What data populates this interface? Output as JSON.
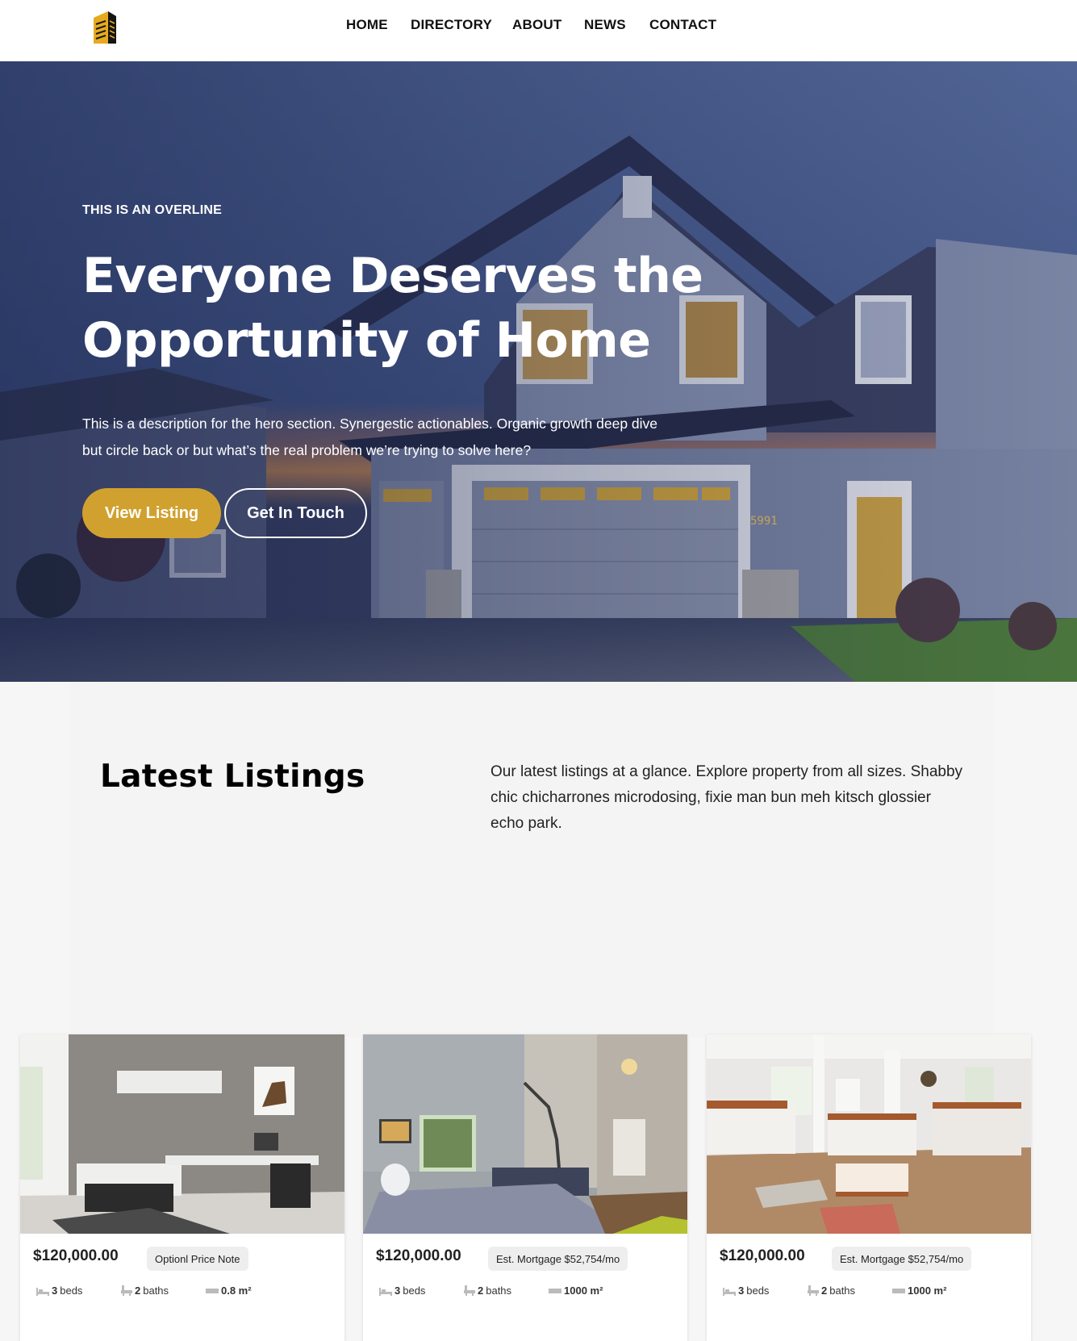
{
  "nav": {
    "logo_icon": "building-logo-icon",
    "items": [
      "HOME",
      "DIRECTORY",
      "ABOUT",
      "NEWS",
      "CONTACT"
    ]
  },
  "hero": {
    "overline": "THIS IS AN OVERLINE",
    "title": "Everyone Deserves the Opportunity of Home",
    "description": "This is a description for the hero section. Synergestic actionables. Organic growth deep dive but circle back or but what’s the real problem we’re trying to solve here?",
    "primary_button": "View Listing",
    "secondary_button": "Get In Touch",
    "house_number": "5991"
  },
  "listings": {
    "title": "Latest Listings",
    "description": "Our latest listings at a glance. Explore property from all sizes. Shabby chic chicharrones microdosing, fixie man bun meh kitsch glossier echo park."
  },
  "cards": [
    {
      "price": "$120,000.00",
      "note": "Optionl Price Note",
      "beds_num": "3",
      "beds_label": "beds",
      "baths_num": "2",
      "baths_label": "baths",
      "area": "0.8 m²"
    },
    {
      "price": "$120,000.00",
      "note": "Est. Mortgage $52,754/mo",
      "beds_num": "3",
      "beds_label": "beds",
      "baths_num": "2",
      "baths_label": "baths",
      "area": "1000 m²"
    },
    {
      "price": "$120,000.00",
      "note": "Est. Mortgage $52,754/mo",
      "beds_num": "3",
      "beds_label": "beds",
      "baths_num": "2",
      "baths_label": "baths",
      "area": "1000 m²"
    }
  ],
  "colors": {
    "accent": "#d1a12f",
    "hero_sky": "#4e6293",
    "section_bg": "#f4f4f4"
  }
}
